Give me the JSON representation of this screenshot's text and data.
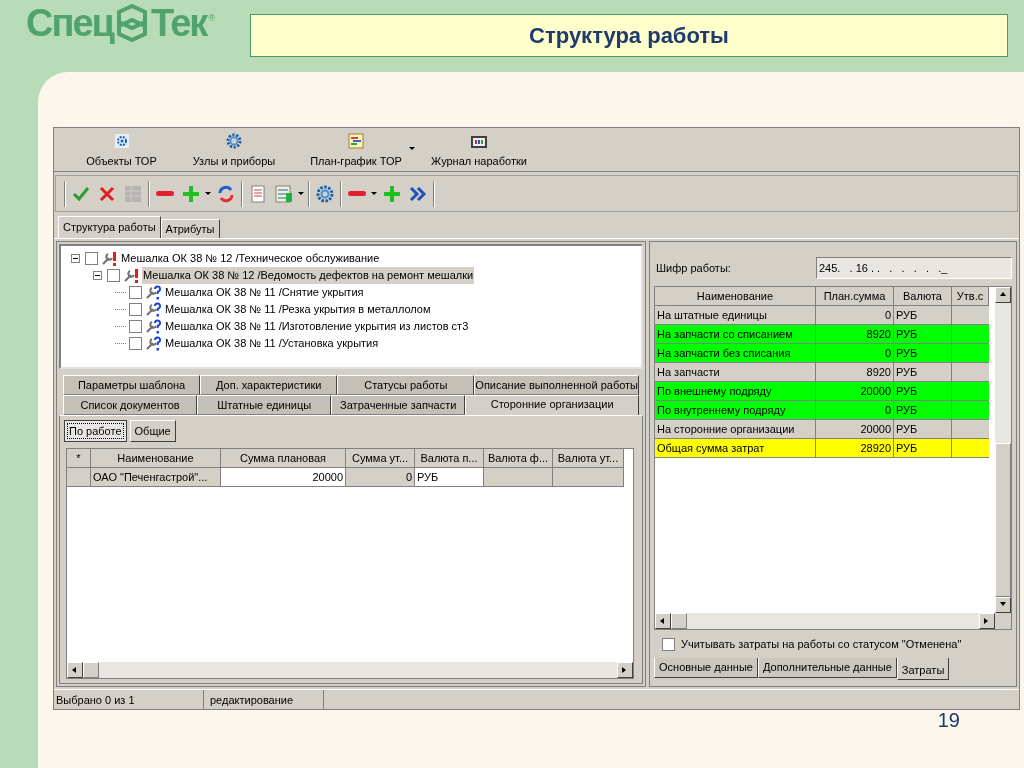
{
  "slide": {
    "logo": {
      "left": "Спец",
      "right": "Тек",
      "mark": "®"
    },
    "title": "Структура работы",
    "page_number": "19"
  },
  "window": {
    "main_toolbar": [
      {
        "label": "Объекты ТОР",
        "dropdown": false
      },
      {
        "label": "Узлы и приборы",
        "dropdown": false
      },
      {
        "label": "План-график ТОР",
        "dropdown": true
      },
      {
        "label": "Журнал наработки",
        "dropdown": false
      }
    ],
    "tool_icons": [
      {
        "kind": "separator"
      },
      {
        "kind": "check",
        "disabled": false,
        "dropdown": false
      },
      {
        "kind": "cross",
        "disabled": false,
        "dropdown": false
      },
      {
        "kind": "table",
        "disabled": true,
        "dropdown": false
      },
      {
        "kind": "separator"
      },
      {
        "kind": "minus",
        "disabled": false,
        "dropdown": false
      },
      {
        "kind": "plus",
        "disabled": false,
        "dropdown": true
      },
      {
        "kind": "refresh",
        "disabled": false,
        "dropdown": false
      },
      {
        "kind": "separator"
      },
      {
        "kind": "document",
        "disabled": false,
        "dropdown": false
      },
      {
        "kind": "sheet",
        "disabled": false,
        "dropdown": true
      },
      {
        "kind": "separator"
      },
      {
        "kind": "gear",
        "disabled": false,
        "dropdown": false
      },
      {
        "kind": "separator"
      },
      {
        "kind": "minus",
        "disabled": false,
        "dropdown": true
      },
      {
        "kind": "plus",
        "disabled": false,
        "dropdown": false
      },
      {
        "kind": "forward",
        "disabled": false,
        "dropdown": false
      },
      {
        "kind": "separator"
      }
    ],
    "tabs": [
      {
        "label": "Структура работы",
        "selected": true
      },
      {
        "label": "Атрибуты",
        "selected": false
      }
    ],
    "tree": [
      {
        "label": "Мешалка ОК 38 № 12 /Техническое обслуживание",
        "kind": "alert",
        "checked": false,
        "selected": false,
        "expanded": true,
        "children": [
          {
            "label": "Мешалка ОК 38 № 12 /Ведомость дефектов на ремонт мешалки",
            "kind": "alert",
            "checked": false,
            "selected": true,
            "expanded": true,
            "children": [
              {
                "label": "Мешалка ОК 38 № 11 /Снятие укрытия",
                "kind": "question",
                "checked": false,
                "selected": false
              },
              {
                "label": "Мешалка ОК 38 № 11 /Резка укрытия в металлолом",
                "kind": "question",
                "checked": false,
                "selected": false
              },
              {
                "label": "Мешалка ОК 38 № 11 /Изготовление укрытия из листов ст3",
                "kind": "question",
                "checked": false,
                "selected": false
              },
              {
                "label": "Мешалка ОК 38 № 11 /Установка укрытия",
                "kind": "question",
                "checked": false,
                "selected": false
              }
            ]
          }
        ]
      }
    ],
    "detail_tabs": [
      [
        {
          "label": "Параметры шаблона",
          "selected": false
        },
        {
          "label": "Доп. характеристики",
          "selected": false
        },
        {
          "label": "Статусы работы",
          "selected": false
        },
        {
          "label": "Описание выполненной работы",
          "selected": false
        }
      ],
      [
        {
          "label": "Список документов",
          "selected": false
        },
        {
          "label": "Штатные единицы",
          "selected": false
        },
        {
          "label": "Затраченные запчасти",
          "selected": false
        },
        {
          "label": "Сторонние организации",
          "selected": true
        }
      ]
    ],
    "filter_buttons": [
      {
        "label": "По работе",
        "selected": true
      },
      {
        "label": "Общие",
        "selected": false
      }
    ],
    "org_table": {
      "columns": [
        "*",
        "Наименование",
        "Сумма плановая",
        "Сумма ут...",
        "Валюта п...",
        "Валюта ф...",
        "Валюта ут..."
      ],
      "rows": [
        {
          "name": "ОАО \"Печенгастрой\"...",
          "planned": "20000",
          "approved": "0",
          "currency": "РУБ"
        }
      ]
    },
    "cost_panel": {
      "code_label": "Шифр работы:",
      "code_value": "245.   . 16 . .   .   .   .   .   ._",
      "columns": [
        "Наименование",
        "План.сумма",
        "Валюта",
        "Утв.с"
      ],
      "rows": [
        {
          "name": "На штатные единицы",
          "sum": "0",
          "currency": "РУБ",
          "color": "#d4d0c8"
        },
        {
          "name": "На запчасти со списанием",
          "sum": "8920",
          "currency": "РУБ",
          "color": "#00ff00"
        },
        {
          "name": "На запчасти без списания",
          "sum": "0",
          "currency": "РУБ",
          "color": "#00ff00"
        },
        {
          "name": "На запчасти",
          "sum": "8920",
          "currency": "РУБ",
          "color": "#d4d0c8"
        },
        {
          "name": "По внешнему подряду",
          "sum": "20000",
          "currency": "РУБ",
          "color": "#00ff00"
        },
        {
          "name": "По внутреннему подряду",
          "sum": "0",
          "currency": "РУБ",
          "color": "#00ff00"
        },
        {
          "name": "На сторонние организации",
          "sum": "20000",
          "currency": "РУБ",
          "color": "#d4d0c8"
        },
        {
          "name": "Общая сумма затрат",
          "sum": "28920",
          "currency": "РУБ",
          "color": "#ffff00"
        }
      ],
      "checkbox": {
        "label": "Учитывать затраты на работы со статусом \"Отменена\"",
        "checked": false
      },
      "tabs": [
        {
          "label": "Основные данные",
          "selected": false
        },
        {
          "label": "Дополнительные данные",
          "selected": false
        },
        {
          "label": "Затраты",
          "selected": true
        }
      ]
    },
    "status_bar": [
      "Выбрано 0 из 1",
      "редактирование"
    ]
  }
}
